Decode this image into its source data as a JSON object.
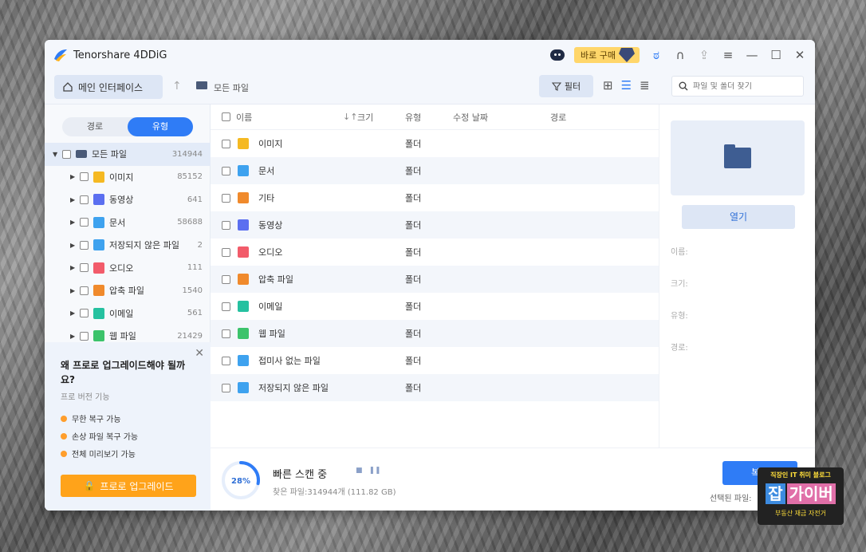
{
  "app": {
    "title": "Tenorshare 4DDiG",
    "buy_label": "바로 구매",
    "window_controls": [
      "minimize-icon",
      "maximize-icon",
      "close-icon"
    ]
  },
  "toolbar": {
    "home_label": "메인 인터페이스",
    "breadcrumb": "모든 파일",
    "filter_label": "필터",
    "search_placeholder": "파일 및 폴더 찾기"
  },
  "sidebar": {
    "tabs": [
      {
        "label": "경로",
        "active": false
      },
      {
        "label": "유형",
        "active": true
      }
    ],
    "root": {
      "label": "모든 파일",
      "count": "314944"
    },
    "items": [
      {
        "label": "이미지",
        "count": "85152",
        "icon": "image-icon",
        "color": "#f5b922"
      },
      {
        "label": "동영상",
        "count": "641",
        "icon": "video-icon",
        "color": "#5b6ff0"
      },
      {
        "label": "문서",
        "count": "58688",
        "icon": "document-icon",
        "color": "#3ea2ef"
      },
      {
        "label": "저장되지 않은 파일",
        "count": "2",
        "icon": "unsaved-file-icon",
        "color": "#3ea2ef"
      },
      {
        "label": "오디오",
        "count": "111",
        "icon": "audio-icon",
        "color": "#f25b6a"
      },
      {
        "label": "압축 파일",
        "count": "1540",
        "icon": "archive-icon",
        "color": "#f08a2c"
      },
      {
        "label": "이메일",
        "count": "561",
        "icon": "email-icon",
        "color": "#25c1a0"
      },
      {
        "label": "웹 파일",
        "count": "21429",
        "icon": "web-icon",
        "color": "#3cc36b"
      }
    ]
  },
  "promo": {
    "title": "왜 프로로 업그레이드해야 될까요?",
    "subtitle": "프로 버전 기능",
    "features": [
      "무한 복구 가능",
      "손상 파일 복구 가능",
      "전체 미리보기 가능"
    ],
    "button": "프로로 업그레이드"
  },
  "filelist": {
    "headers": {
      "name": "이름",
      "size": "크기",
      "type": "유형",
      "modified": "수정 날짜",
      "path": "경로"
    },
    "rows": [
      {
        "name": "이미지",
        "type": "폴더",
        "icon": "image-icon",
        "color": "#f5b922"
      },
      {
        "name": "문서",
        "type": "폴더",
        "icon": "document-icon",
        "color": "#3ea2ef"
      },
      {
        "name": "기타",
        "type": "폴더",
        "icon": "other-icon",
        "color": "#f08a2c"
      },
      {
        "name": "동영상",
        "type": "폴더",
        "icon": "video-icon",
        "color": "#5b6ff0"
      },
      {
        "name": "오디오",
        "type": "폴더",
        "icon": "audio-icon",
        "color": "#f25b6a"
      },
      {
        "name": "압축 파일",
        "type": "폴더",
        "icon": "archive-icon",
        "color": "#f08a2c"
      },
      {
        "name": "이메일",
        "type": "폴더",
        "icon": "email-icon",
        "color": "#25c1a0"
      },
      {
        "name": "웹 파일",
        "type": "폴더",
        "icon": "web-icon",
        "color": "#3cc36b"
      },
      {
        "name": "접미사 없는 파일",
        "type": "폴더",
        "icon": "unknown-file-icon",
        "color": "#3ea2ef"
      },
      {
        "name": "저장되지 않은 파일",
        "type": "폴더",
        "icon": "unsaved-file-icon",
        "color": "#3ea2ef"
      }
    ]
  },
  "detail": {
    "open_label": "열기",
    "name_label": "이름:",
    "size_label": "크기:",
    "type_label": "유형:",
    "path_label": "경로:"
  },
  "scan": {
    "progress": "28%",
    "progress_value": 0.28,
    "title": "빠른 스캔 중",
    "found": "찾은 파일:314944개 (111.82 GB)",
    "recover_label": "복구",
    "selected_label": "선택된 파일:"
  },
  "watermark": {
    "top": "직장인 IT 취미 블로그",
    "main": [
      "잡",
      "가이버"
    ],
    "bottom": "부동산 재금 자전거"
  }
}
